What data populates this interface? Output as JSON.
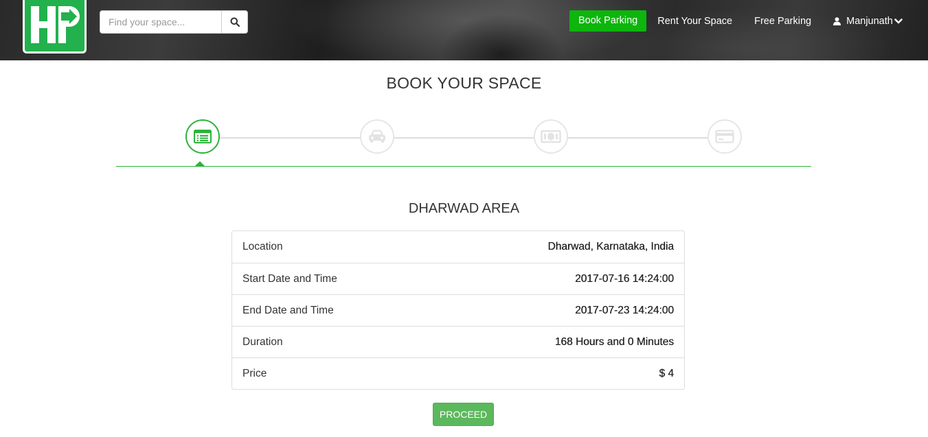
{
  "header": {
    "logo_text": "HP",
    "search": {
      "placeholder": "Find your space..."
    },
    "nav": {
      "book_parking": "Book Parking",
      "rent_your_space": "Rent Your Space",
      "free_parking": "Free Parking",
      "user_name": "Manjunath"
    },
    "colors": {
      "accent": "#0db50d",
      "logo_green": "#22b14c"
    }
  },
  "page": {
    "title": "BOOK YOUR SPACE",
    "steps": [
      {
        "icon": "list-icon",
        "active": true
      },
      {
        "icon": "car-icon",
        "active": false
      },
      {
        "icon": "money-icon",
        "active": false
      },
      {
        "icon": "credit-card-icon",
        "active": false
      }
    ],
    "area_title": "DHARWAD AREA",
    "details": [
      {
        "label": "Location",
        "value": "Dharwad, Karnataka, India"
      },
      {
        "label": "Start Date and Time",
        "value": "2017-07-16 14:24:00"
      },
      {
        "label": "End Date and Time",
        "value": "2017-07-23 14:24:00"
      },
      {
        "label": "Duration",
        "value": "168 Hours and 0 Minutes"
      },
      {
        "label": "Price",
        "value": "$ 4"
      }
    ],
    "proceed_label": "PROCEED"
  }
}
